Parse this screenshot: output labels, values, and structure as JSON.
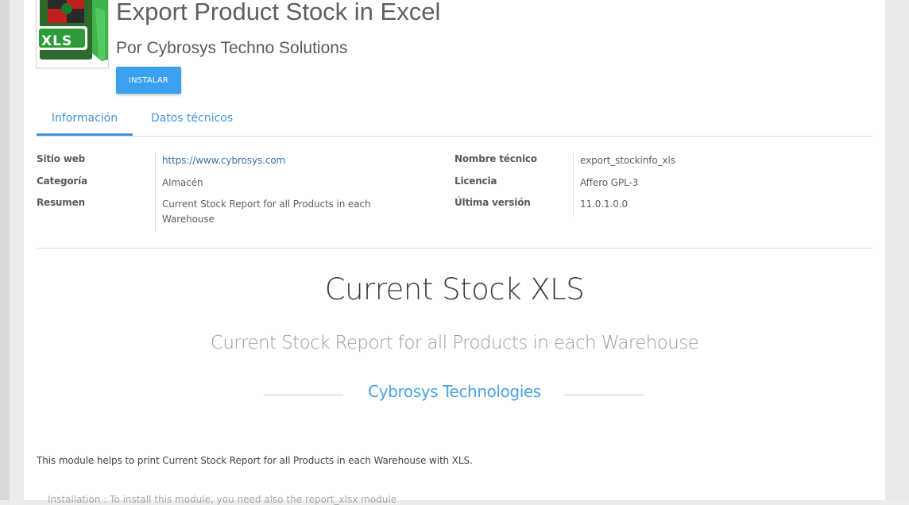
{
  "module": {
    "title": "Export Product Stock in Excel",
    "author": "Por Cybrosys Techno Solutions",
    "install_label": "INSTALAR",
    "icon_text": "XLS",
    "icon_name": "xls-file-icon"
  },
  "tabs": [
    {
      "label": "Información",
      "active": true
    },
    {
      "label": "Datos técnicos",
      "active": false
    }
  ],
  "info_left": [
    {
      "label": "Sitio web",
      "value": "https://www.cybrosys.com",
      "link": true
    },
    {
      "label": "Categoría",
      "value": "Almacén"
    },
    {
      "label": "Resumen",
      "value": "Current Stock Report for all Products in each Warehouse"
    }
  ],
  "info_right": [
    {
      "label": "Nombre técnico",
      "value": "export_stockinfo_xls"
    },
    {
      "label": "Licencia",
      "value": "Affero GPL-3"
    },
    {
      "label": "Última versión",
      "value": "11.0.1.0.0"
    }
  ],
  "content": {
    "heading": "Current Stock XLS",
    "subheading": "Current Stock Report for all Products in each Warehouse",
    "company": "Cybrosys Technologies",
    "description": "This module helps to print Current Stock Report for all Products in each Warehouse with XLS.",
    "next_line": "Installation : To install this module, you need also the report_xlsx module"
  },
  "colors": {
    "accent": "#3aa1f0",
    "link": "#3d6fa8",
    "tab": "#3d95df",
    "company": "#4aa3e4",
    "icon_green": "#2e9b3a"
  }
}
